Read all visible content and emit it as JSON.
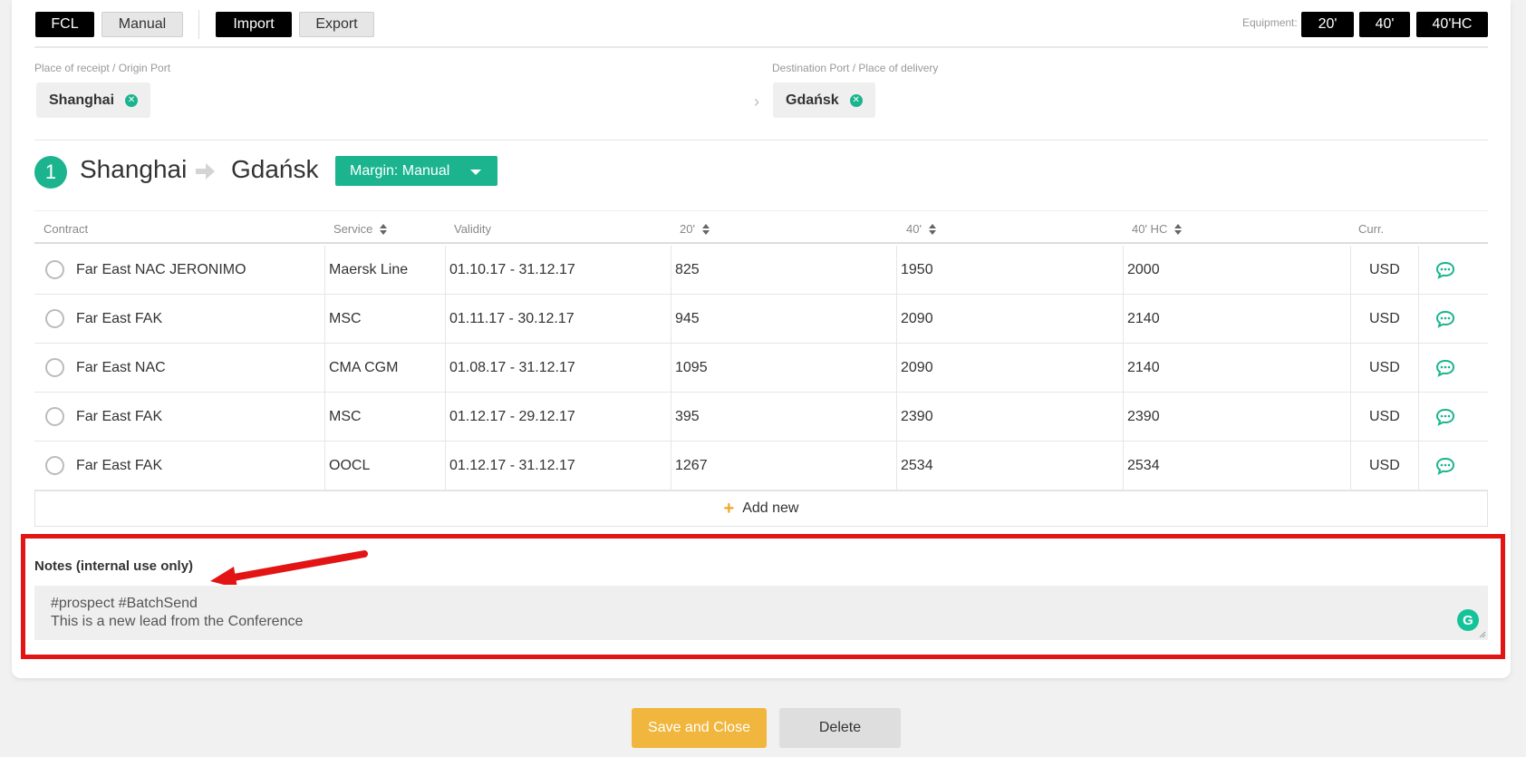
{
  "toolbar": {
    "mode_fcl": "FCL",
    "mode_manual": "Manual",
    "import": "Import",
    "export": "Export",
    "equipment_label": "Equipment:",
    "equipment": [
      "20'",
      "40'",
      "40'HC"
    ]
  },
  "ports": {
    "origin_label": "Place of receipt / Origin Port",
    "origin_value": "Shanghai",
    "destination_label": "Destination Port / Place of delivery",
    "destination_value": "Gdańsk"
  },
  "route": {
    "step": "1",
    "from": "Shanghai",
    "to": "Gdańsk",
    "margin_label": "Margin: Manual"
  },
  "table": {
    "headers": {
      "contract": "Contract",
      "service": "Service",
      "validity": "Validity",
      "c20": "20'",
      "c40": "40'",
      "c40hc": "40' HC",
      "curr": "Curr."
    },
    "rows": [
      {
        "contract": "Far East NAC JERONIMO",
        "service": "Maersk Line",
        "validity": "01.10.17 - 31.12.17",
        "c20": "825",
        "c40": "1950",
        "c40hc": "2000",
        "curr": "USD"
      },
      {
        "contract": "Far East FAK",
        "service": "MSC",
        "validity": "01.11.17 - 30.12.17",
        "c20": "945",
        "c40": "2090",
        "c40hc": "2140",
        "curr": "USD"
      },
      {
        "contract": "Far East NAC",
        "service": "CMA CGM",
        "validity": "01.08.17 - 31.12.17",
        "c20": "1095",
        "c40": "2090",
        "c40hc": "2140",
        "curr": "USD"
      },
      {
        "contract": "Far East FAK",
        "service": "MSC",
        "validity": "01.12.17 - 29.12.17",
        "c20": "395",
        "c40": "2390",
        "c40hc": "2390",
        "curr": "USD"
      },
      {
        "contract": "Far East FAK",
        "service": "OOCL",
        "validity": "01.12.17 - 31.12.17",
        "c20": "1267",
        "c40": "2534",
        "c40hc": "2534",
        "curr": "USD"
      }
    ],
    "add_new": "Add new"
  },
  "notes": {
    "label": "Notes (internal use only)",
    "value": "#prospect #BatchSend\nThis is a new lead from the Conference"
  },
  "footer": {
    "save_label": "Save and Close",
    "delete_label": "Delete"
  },
  "colors": {
    "accent": "#1bb48f",
    "save": "#f0b63d",
    "highlight": "#e21414"
  }
}
